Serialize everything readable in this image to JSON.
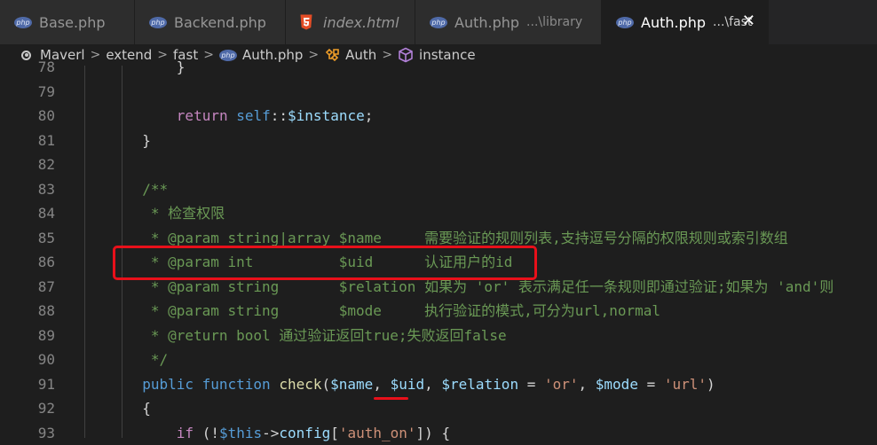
{
  "tabs": [
    {
      "title": "Base.php",
      "icon": "php-icon",
      "italic": false
    },
    {
      "title": "Backend.php",
      "icon": "php-icon",
      "italic": false
    },
    {
      "title": "index.html",
      "icon": "html5-icon",
      "italic": true
    },
    {
      "title": "Auth.php",
      "description": "...\\library",
      "icon": "php-icon",
      "italic": false
    },
    {
      "title": "Auth.php",
      "description": "...\\fast",
      "icon": "php-icon",
      "italic": false,
      "active": true,
      "close": "✕"
    }
  ],
  "breadcrumbs": [
    "Maverl",
    "extend",
    "fast",
    "Auth.php",
    "Auth",
    "instance"
  ],
  "icon_labels": {
    "php": "php"
  },
  "code_lines": [
    {
      "num": "78",
      "indent": 12,
      "tokens": [
        {
          "t": "}",
          "c": "op"
        }
      ]
    },
    {
      "num": "79",
      "indent": 0,
      "tokens": []
    },
    {
      "num": "80",
      "indent": 12,
      "tokens": [
        {
          "t": "return",
          "c": "kf"
        },
        {
          "t": " ",
          "c": "op"
        },
        {
          "t": "self",
          "c": "kw"
        },
        {
          "t": "::",
          "c": "op"
        },
        {
          "t": "$instance",
          "c": "var"
        },
        {
          "t": ";",
          "c": "op"
        }
      ]
    },
    {
      "num": "81",
      "indent": 8,
      "tokens": [
        {
          "t": "}",
          "c": "op"
        }
      ]
    },
    {
      "num": "82",
      "indent": 0,
      "tokens": []
    },
    {
      "num": "83",
      "indent": 8,
      "tokens": [
        {
          "t": "/**",
          "c": "cm"
        }
      ]
    },
    {
      "num": "84",
      "indent": 8,
      "tokens": [
        {
          "t": " * 检查权限",
          "c": "cm"
        }
      ]
    },
    {
      "num": "85",
      "indent": 8,
      "tokens": [
        {
          "t": " * @param string|array $name     需要验证的规则列表,支持逗号分隔的权限规则或索引数组",
          "c": "cm"
        }
      ]
    },
    {
      "num": "86",
      "indent": 8,
      "tokens": [
        {
          "t": " * @param int          $uid      认证用户的id",
          "c": "cm"
        }
      ]
    },
    {
      "num": "87",
      "indent": 8,
      "tokens": [
        {
          "t": " * @param string       $relation 如果为 'or' 表示满足任一条规则即通过验证;如果为 'and'则",
          "c": "cm"
        }
      ]
    },
    {
      "num": "88",
      "indent": 8,
      "tokens": [
        {
          "t": " * @param string       $mode     执行验证的模式,可分为url,normal",
          "c": "cm"
        }
      ]
    },
    {
      "num": "89",
      "indent": 8,
      "tokens": [
        {
          "t": " * @return bool 通过验证返回true;失败返回false",
          "c": "cm"
        }
      ]
    },
    {
      "num": "90",
      "indent": 8,
      "tokens": [
        {
          "t": " */",
          "c": "cm"
        }
      ]
    },
    {
      "num": "91",
      "indent": 8,
      "tokens": [
        {
          "t": "public",
          "c": "kw"
        },
        {
          "t": " ",
          "c": "op"
        },
        {
          "t": "function",
          "c": "kw"
        },
        {
          "t": " ",
          "c": "op"
        },
        {
          "t": "check",
          "c": "fn"
        },
        {
          "t": "(",
          "c": "op"
        },
        {
          "t": "$name",
          "c": "var"
        },
        {
          "t": ", ",
          "c": "op"
        },
        {
          "t": "$uid",
          "c": "var"
        },
        {
          "t": ", ",
          "c": "op"
        },
        {
          "t": "$relation",
          "c": "var"
        },
        {
          "t": " = ",
          "c": "op"
        },
        {
          "t": "'or'",
          "c": "str"
        },
        {
          "t": ", ",
          "c": "op"
        },
        {
          "t": "$mode",
          "c": "var"
        },
        {
          "t": " = ",
          "c": "op"
        },
        {
          "t": "'url'",
          "c": "str"
        },
        {
          "t": ")",
          "c": "op"
        }
      ]
    },
    {
      "num": "92",
      "indent": 8,
      "tokens": [
        {
          "t": "{",
          "c": "op"
        }
      ]
    },
    {
      "num": "93",
      "indent": 12,
      "tokens": [
        {
          "t": "if",
          "c": "kf"
        },
        {
          "t": " (!",
          "c": "op"
        },
        {
          "t": "$this",
          "c": "kw"
        },
        {
          "t": "->",
          "c": "op"
        },
        {
          "t": "config",
          "c": "var"
        },
        {
          "t": "[",
          "c": "op"
        },
        {
          "t": "'auth_on'",
          "c": "str"
        },
        {
          "t": "]) {",
          "c": "op"
        }
      ]
    }
  ],
  "colors": {
    "annotation": "#e8101a",
    "comment": "#6a9955",
    "keyword": "#569cd6",
    "variable": "#9cdcfe",
    "function": "#dcdcaa",
    "string": "#ce9178"
  }
}
